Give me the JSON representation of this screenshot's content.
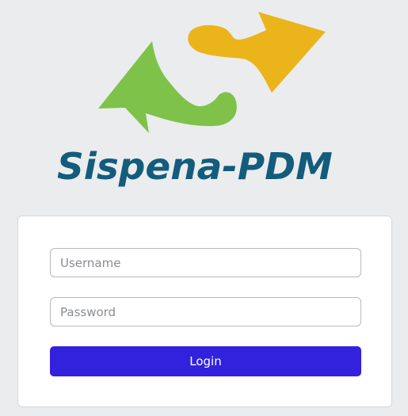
{
  "brand": {
    "name": "Sispena-PDM",
    "logo_icon": "s-arrows-logo-icon",
    "colors": {
      "green": "#7fc24a",
      "yellow": "#ebb41a",
      "text": "#135c7c"
    }
  },
  "login_form": {
    "username_placeholder": "Username",
    "username_value": "",
    "password_placeholder": "Password",
    "password_value": "",
    "login_label": "Login",
    "button_color": "#3222dd"
  }
}
